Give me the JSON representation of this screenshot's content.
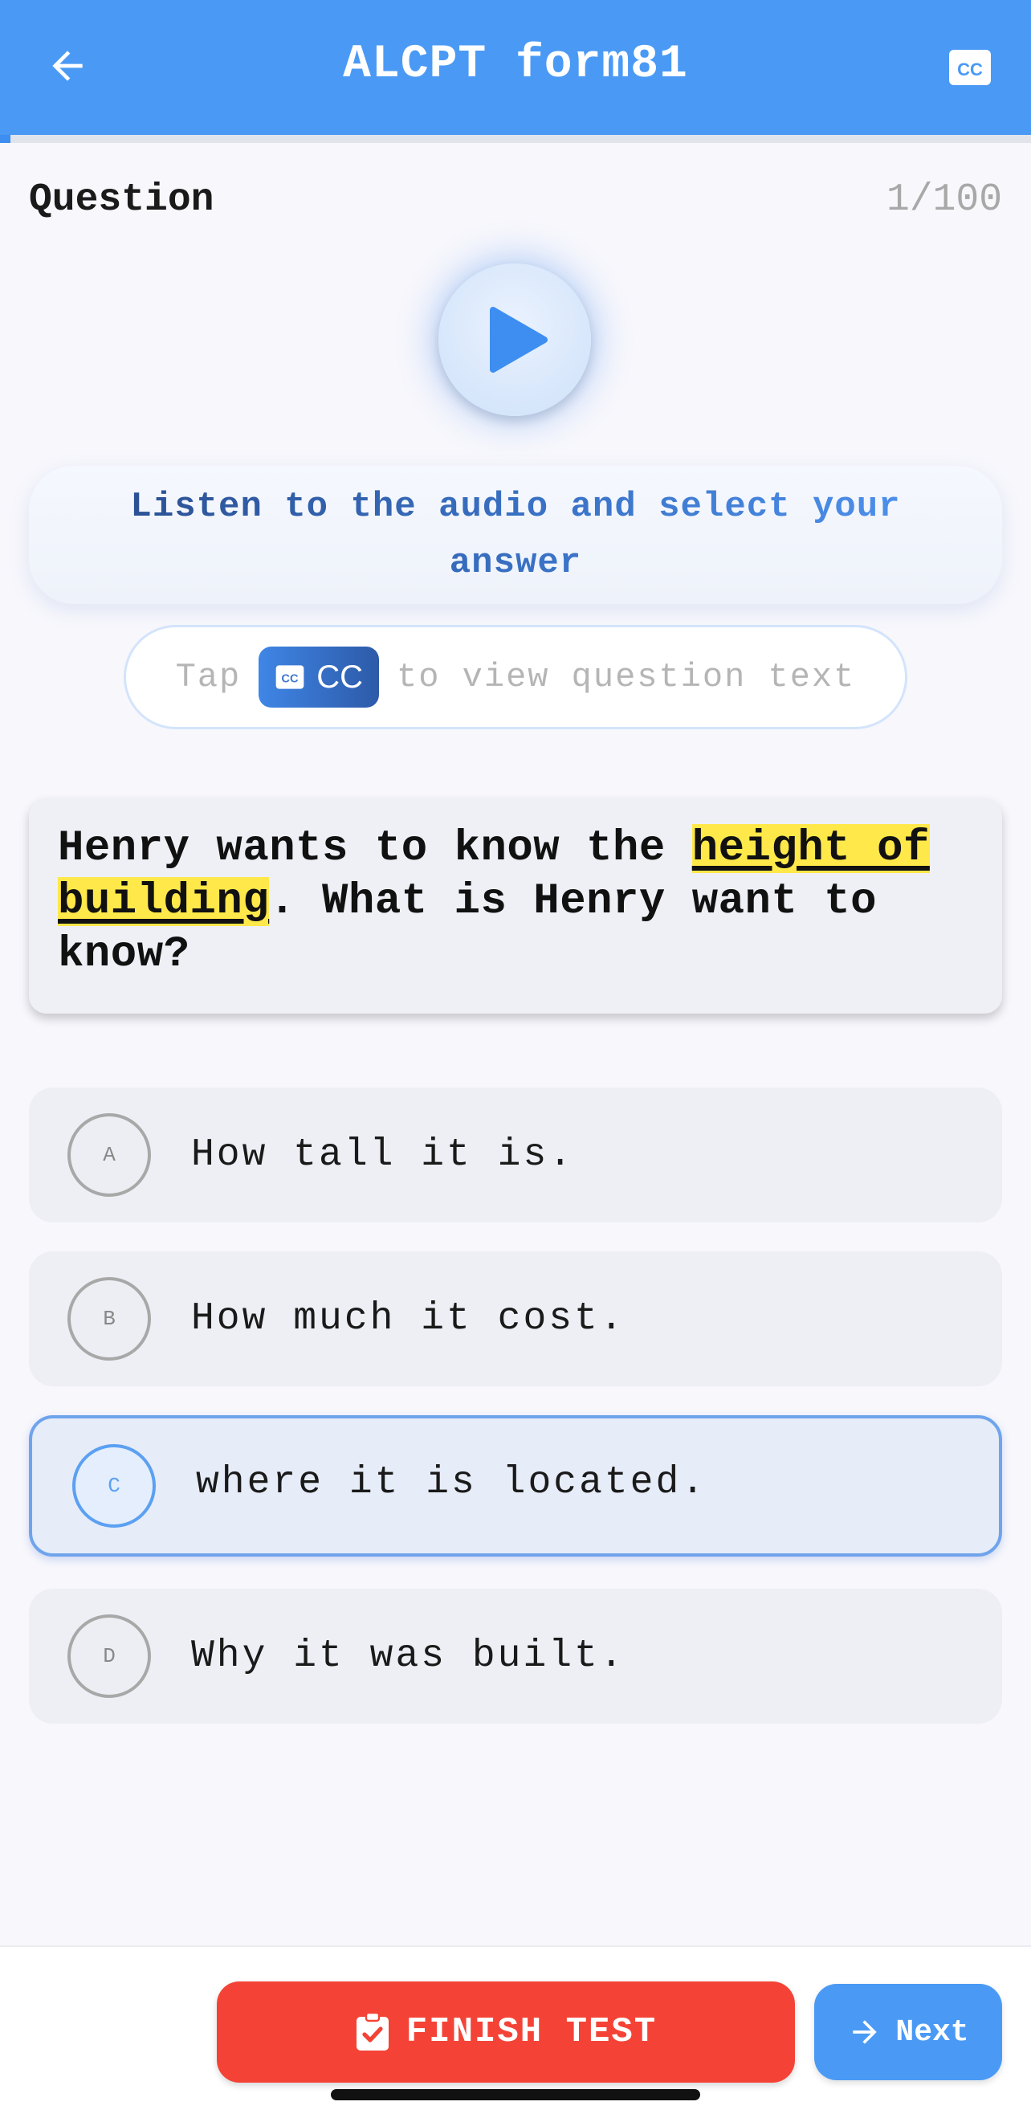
{
  "header": {
    "title": "ALCPT form81",
    "back_icon": "arrow-left-icon",
    "cc_icon": "closed-captions-icon",
    "background_color": "#4a9af5",
    "progress_fraction": 0.01
  },
  "question": {
    "label": "Question",
    "counter": "1/100",
    "play_icon": "play-icon"
  },
  "instruction": {
    "text": "Listen to the audio and select your answer"
  },
  "cc_hint": {
    "prefix": "Tap",
    "chip_label": "CC",
    "suffix": "to view question text"
  },
  "question_text": {
    "before": "Henry wants to know the ",
    "highlight": "height of building",
    "after": ". What is Henry want to know?"
  },
  "options": [
    {
      "letter": "A",
      "text": "How tall it is.",
      "selected": false
    },
    {
      "letter": "B",
      "text": "How much it cost.",
      "selected": false
    },
    {
      "letter": "C",
      "text": "where it is located.",
      "selected": true
    },
    {
      "letter": "D",
      "text": "Why it was built.",
      "selected": false
    }
  ],
  "footer": {
    "finish_label": "FINISH TEST",
    "finish_icon": "clipboard-check-icon",
    "finish_color": "#f44336",
    "next_label": "Next",
    "next_icon": "arrow-right-icon",
    "next_color": "#4a9af5"
  }
}
